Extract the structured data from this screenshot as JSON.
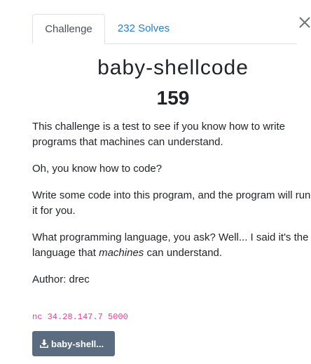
{
  "tabs": {
    "challenge": "Challenge",
    "solves": "232 Solves"
  },
  "challenge": {
    "name": "baby-shellcode",
    "points": "159",
    "description": [
      "This challenge is a test to see if you know how to write programs that machines can understand.",
      "Oh, you know how to code?",
      "Write some code into this program, and the program will run it for you."
    ],
    "desc_p4_before": "What programming language, you ask? Well... I said it's the language that ",
    "desc_p4_em": "machines",
    "desc_p4_after": " can understand.",
    "author": "Author: drec",
    "connection": "nc 34.28.147.7 5000",
    "file_button": "baby-shell..."
  },
  "icons": {
    "close": "close-icon",
    "download": "download-icon"
  },
  "colors": {
    "link": "#1e7fd6",
    "code": "#e83e8c",
    "file_button": "#5b6b80"
  }
}
